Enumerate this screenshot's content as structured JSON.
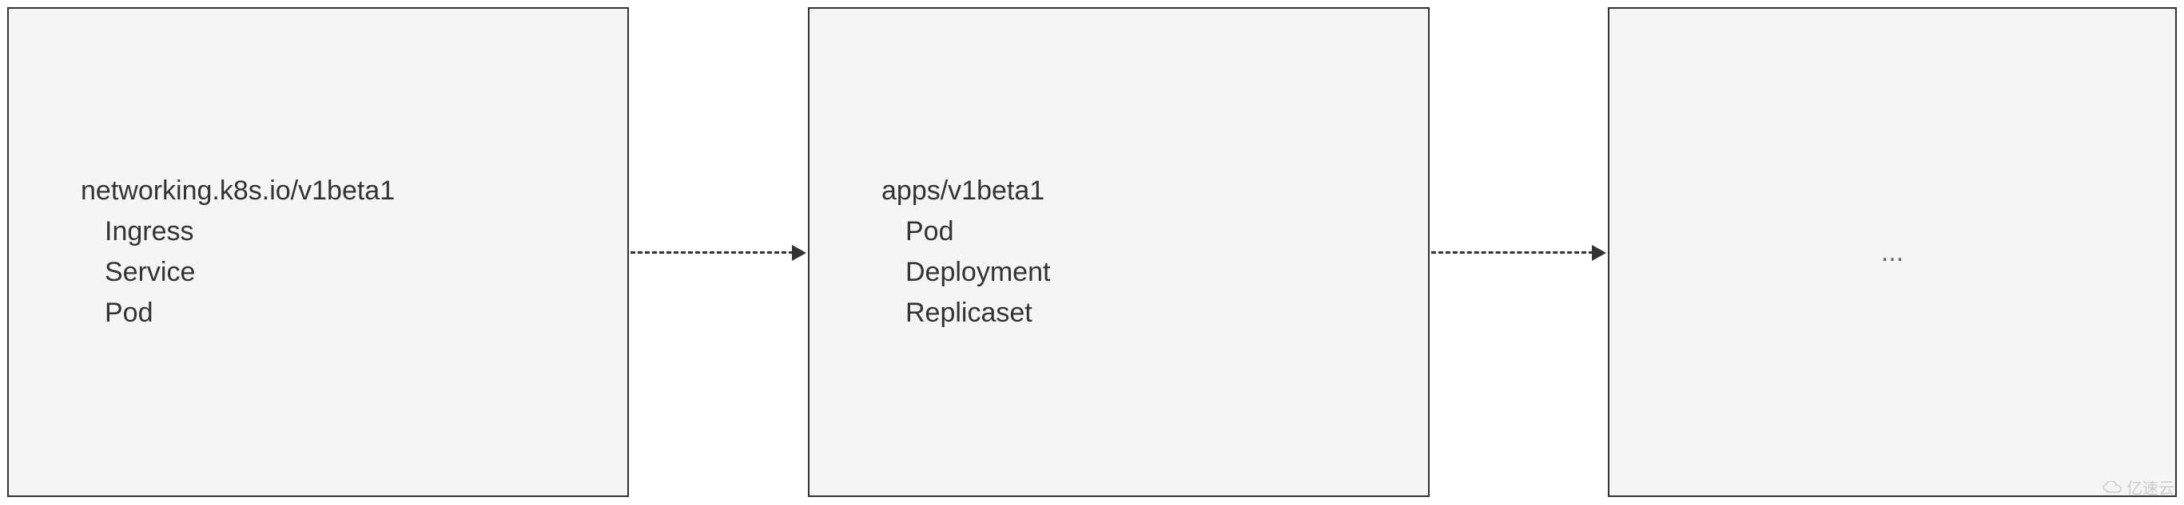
{
  "boxes": [
    {
      "title": "networking.k8s.io/v1beta1",
      "resources": [
        "Ingress",
        "Service",
        "Pod"
      ]
    },
    {
      "title": "apps/v1beta1",
      "resources": [
        "Pod",
        "Deployment",
        "Replicaset"
      ]
    },
    {
      "title": "...",
      "resources": []
    }
  ],
  "watermark": {
    "text": "亿速云"
  }
}
